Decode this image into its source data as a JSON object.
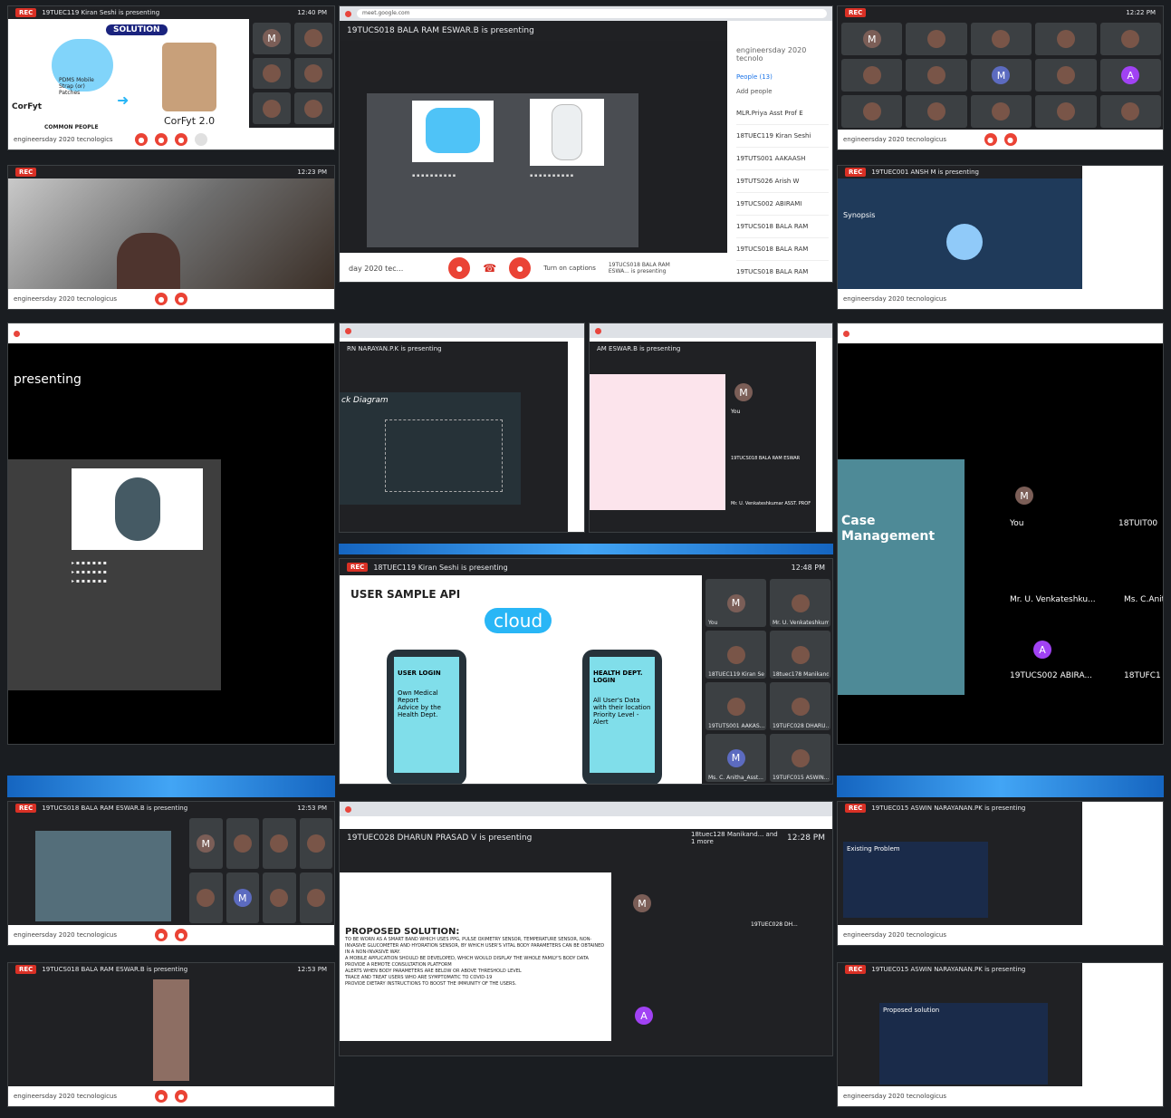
{
  "collage": {
    "t1": {
      "presenter": "19TUEC119 Kiran Seshi is presenting",
      "time": "12:40 PM",
      "solution": "SOLUTION",
      "corfyt": "CorFyt",
      "corfyt2": "CorFyt 2.0",
      "strap": "PDMS Mobile Strap (or) Patches",
      "common": "COMMON PEOPLE",
      "meet": "engineersday 2020 tecnologics"
    },
    "t2": {
      "url": "meet.google.com",
      "presenter": "19TUCS018 BALA RAM ESWAR.B is presenting",
      "side_title": "engineersday 2020 tecnolo",
      "people": "People (13)",
      "add": "Add people",
      "people_list": [
        "MLR.Priya Asst Prof E",
        "18TUEC119 Kiran Seshi",
        "19TUTS001 AAKAASH",
        "19TUTS026 Arish W",
        "19TUCS002 ABIRAMI",
        "19TUCS018 BALA RAM",
        "19TUCS018 BALA RAM",
        "19TUCS018 BALA RAM"
      ],
      "captions": "Turn on captions",
      "presenting": "19TUCS018 BALA RAM ESWA... is presenting",
      "meet": "day 2020 tec..."
    },
    "t3": {
      "time": "12:22 PM",
      "meet": "engineersday 2020 tecnologicus"
    },
    "t4": {
      "time": "12:23 PM",
      "meet": "engineersday 2020 tecnologicus"
    },
    "t5": {
      "presenter": "19TUEC001 ANSH M is presenting",
      "synopsis": "Synopsis",
      "meet": "engineersday 2020 tecnologicus"
    },
    "t6": {
      "presenting": "presenting"
    },
    "t7": {
      "presenter": "RN NARAYAN.P.K is presenting",
      "diagram": "ck Diagram"
    },
    "t8": {
      "presenter": "AM ESWAR.B is presenting",
      "you": "You",
      "n1": "19TUCS018 BALA RAM ESWAR",
      "n2": "Mr. U. Venkateshkumar ASST. PROF"
    },
    "t9": {
      "presenter": "18TUEC119 Kiran Seshi is presenting",
      "time": "12:48 PM",
      "title": "USER SAMPLE API",
      "cloud": "cloud",
      "login1": "USER LOGIN",
      "items1": [
        "Own Medical Report",
        "Advice by the Health Dept."
      ],
      "login2": "HEALTH DEPT. LOGIN",
      "items2": [
        "All User's Data with their location",
        "Priority Level - Alert"
      ],
      "people": [
        "You",
        "Mr. U. Venkateshkum...",
        "18TUEC119 Kiran Se...",
        "18tuec178 Manikand...",
        "19TUTS001 AAKAS...",
        "19TUFC028 DHARU...",
        "Ms. C. Anitha_Asst...",
        "19TUFC015 ASWIN..."
      ]
    },
    "t10": {
      "case": "Case Management",
      "you": "You",
      "p1": "18TUIT00",
      "p2": "Mr. U. Venkateshku...",
      "p3": "Ms. C.Anit",
      "p4": "19TUCS002 ABIRA...",
      "p5": "18TUFC1"
    },
    "t11": {
      "presenter": "19TUCS018 BALA RAM ESWAR.B is presenting",
      "time": "12:53 PM",
      "meet": "engineersday 2020 tecnologicus"
    },
    "t12": {
      "presenter": "19TUEC028 DHARUN PRASAD V is presenting",
      "more": "18tuec128 Manikand... and 1 more",
      "time": "12:28 PM",
      "solution": "PROPOSED SOLUTION:",
      "lines": [
        "TO BE WORN AS A SMART BAND WHICH USES PPG, PULSE OXIMETRY SENSOR, TEMPERATURE SENSOR, NON-INVASIVE GLUCOMETER AND HYDRATION SENSOR, BY WHICH USER'S VITAL BODY PARAMETERS CAN BE OBTAINED IN A NON-INVASIVE WAY.",
        "A MOBILE APPLICATION SHOULD BE DEVELOPED, WHICH WOULD DISPLAY THE WHOLE FAMILY'S BODY DATA",
        "PROVIDE A REMOTE CONSULTATION PLATFORM",
        "ALERTS WHEN BODY PARAMETERS ARE BELOW OR ABOVE THRESHOLD LEVEL",
        "TRACE AND TREAT USERS WHO ARE SYMPTOMATIC TO COVID-19",
        "PROVIDE DIETARY INSTRUCTIONS TO BOOST THE IMMUNITY OF THE USERS."
      ],
      "badge": "19TUEC028 DH..."
    },
    "t13": {
      "presenter": "19TUEC015 ASWIN NARAYANAN.PK is presenting",
      "existing": "Existing Problem",
      "meet": "engineersday 2020 tecnologicus"
    },
    "t14": {
      "presenter": "19TUCS018 BALA RAM ESWAR.B is presenting",
      "time": "12:53 PM",
      "meet": "engineersday 2020 tecnologicus"
    },
    "t15": {
      "presenter": "19TUEC015 ASWIN NARAYANAN.PK is presenting",
      "proposed": "Proposed solution",
      "meet": "engineersday 2020 tecnologicus"
    }
  }
}
